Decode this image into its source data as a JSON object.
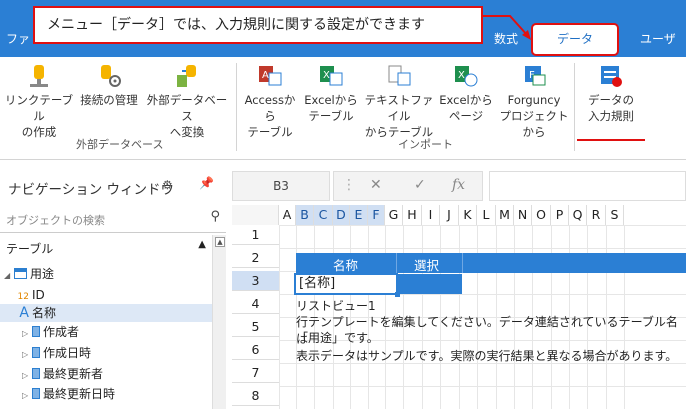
{
  "ribbon": {
    "tabs": {
      "file": "ファ",
      "formula": "数式",
      "data": "データ",
      "user": "ユーザ"
    },
    "callout": "メニュー［データ］では、入力規則に関する設定ができます",
    "groups": {
      "external": "外部データベース",
      "import": "インポート"
    },
    "buttons": {
      "link_table": [
        "リンクテーブル",
        "の作成"
      ],
      "manage_conn": [
        "接続の管理",
        ""
      ],
      "external_convert": [
        "外部データベース",
        "へ変換"
      ],
      "access": [
        "Accessから",
        "テーブル"
      ],
      "excel_table": [
        "Excelから",
        "テーブル"
      ],
      "text_table": [
        "テキストファイル",
        "からテーブル"
      ],
      "excel_page": [
        "Excelから",
        "ページ"
      ],
      "forguncy": [
        "Forguncy",
        "プロジェクトから"
      ],
      "validation": [
        "データの",
        "入力規則"
      ]
    }
  },
  "formula_bar": {
    "name_box": "B3",
    "cancel": "✕",
    "confirm": "✓",
    "fx": "fx"
  },
  "nav": {
    "title": "ナビゲーション ウィンドウ",
    "search_placeholder": "オブジェクトの検索",
    "section": "テーブル",
    "items": [
      {
        "label": "用途"
      },
      {
        "label": "ID",
        "prefix": "12"
      },
      {
        "label": "名称",
        "prefix": "A"
      },
      {
        "label": "作成者"
      },
      {
        "label": "作成日時"
      },
      {
        "label": "最終更新者"
      },
      {
        "label": "最終更新日時"
      }
    ]
  },
  "grid": {
    "columns": [
      "A",
      "B",
      "C",
      "D",
      "E",
      "F",
      "G",
      "H",
      "I",
      "J",
      "K",
      "L",
      "M",
      "N",
      "O",
      "P",
      "Q",
      "R",
      "S"
    ],
    "rows": [
      "1",
      "2",
      "3",
      "4",
      "5",
      "6",
      "7",
      "8"
    ],
    "header_labels": [
      "名称",
      "選択"
    ],
    "b3_value": "[名称]",
    "listview_lines": [
      "リストビュー1",
      "行テンプレートを編集してください。データ連結されているテーブル名は",
      "「用途」です。",
      "表示データはサンプルです。実際の実行結果と異なる場合があります。"
    ]
  },
  "colors": {
    "accent": "#2b7fd4",
    "highlight": "#e01010"
  }
}
